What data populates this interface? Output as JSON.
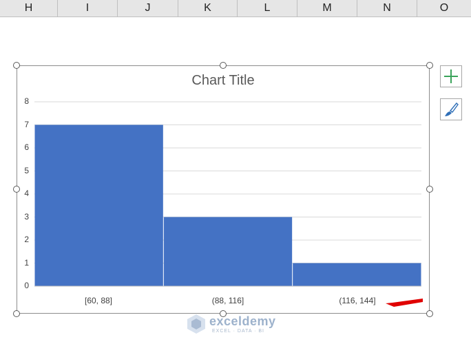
{
  "columns": [
    "H",
    "I",
    "J",
    "K",
    "L",
    "M",
    "N",
    "O"
  ],
  "chart_data": {
    "type": "bar",
    "title": "Chart Title",
    "categories": [
      "[60, 88]",
      "(88, 116]",
      "(116, 144]"
    ],
    "values": [
      7,
      3,
      1
    ],
    "ylim": [
      0,
      8
    ],
    "yticks": [
      0,
      1,
      2,
      3,
      4,
      5,
      6,
      7,
      8
    ],
    "grid": true,
    "legend": "none",
    "bar_color": "#4472c4",
    "xlabel": "",
    "ylabel": ""
  },
  "colors": {
    "bar": "#4472c4",
    "gridline": "#d9d9d9",
    "arrow": "#e00000",
    "plus_icon": "#3aa35a",
    "brush_icon": "#2f6fb7"
  },
  "side_buttons": {
    "add_icon": "plus-icon",
    "style_icon": "brush-icon"
  },
  "watermark": {
    "name": "exceldemy",
    "tagline": "EXCEL · DATA · BI"
  }
}
